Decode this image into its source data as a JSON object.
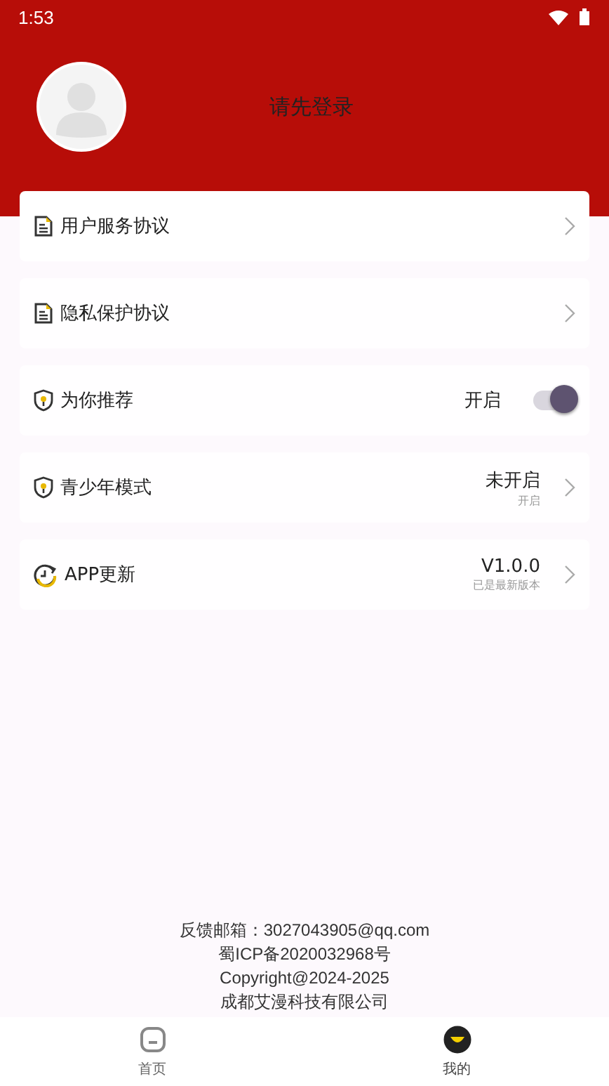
{
  "status_bar": {
    "time": "1:53"
  },
  "profile": {
    "login_prompt": "请先登录"
  },
  "settings": [
    {
      "kind": "link",
      "label": "用户服务协议"
    },
    {
      "kind": "link",
      "label": "隐私保护协议"
    },
    {
      "kind": "toggle",
      "label": "为你推荐",
      "value": "开启",
      "on": true
    },
    {
      "kind": "status",
      "label": "青少年模式",
      "value": "未开启",
      "subtext": "开启"
    },
    {
      "kind": "status",
      "label": "APP更新",
      "value": "V1.0.0",
      "subtext": "已是最新版本"
    }
  ],
  "footer": [
    "反馈邮箱：3027043905@qq.com",
    "蜀ICP备2020032968号",
    "Copyright@2024-2025",
    "成都艾漫科技有限公司"
  ],
  "tabs": [
    {
      "label": "首页",
      "selected": false
    },
    {
      "label": "我的",
      "selected": true
    }
  ]
}
